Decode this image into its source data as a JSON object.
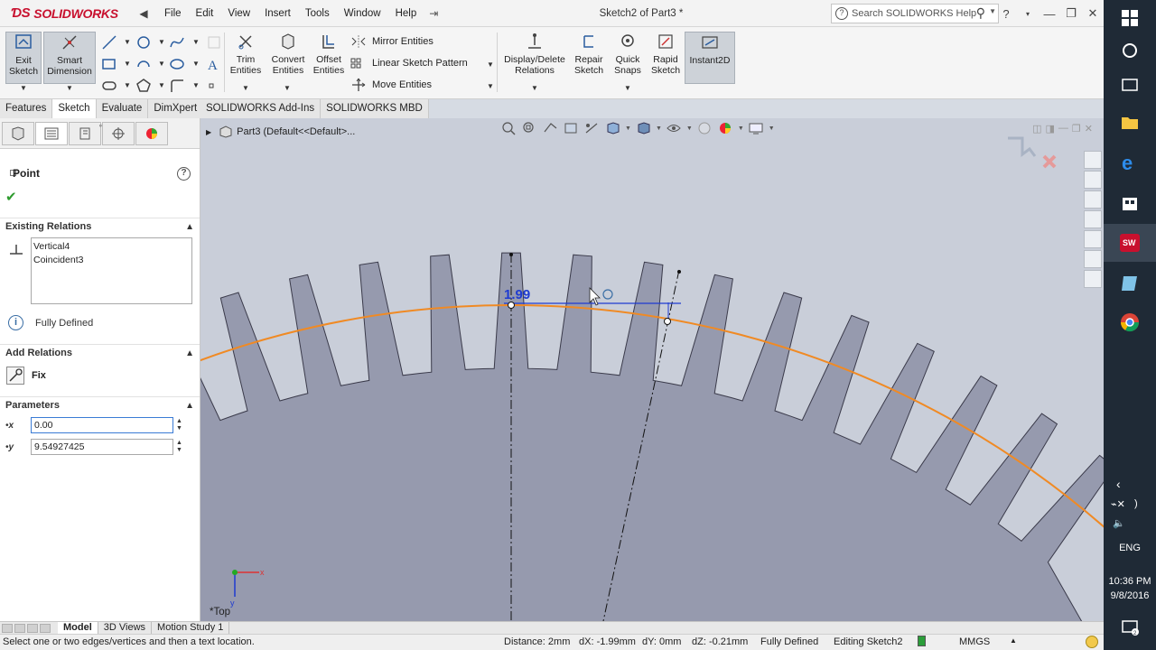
{
  "app": {
    "brand": "SOLIDWORKS",
    "document_title": "Sketch2 of Part3 *",
    "menu": [
      "File",
      "Edit",
      "View",
      "Insert",
      "Tools",
      "Window",
      "Help"
    ],
    "help_search_placeholder": "Search SOLIDWORKS Help"
  },
  "toolbar": {
    "exit_sketch": "Exit Sketch",
    "smart_dimension": "Smart Dimension",
    "trim_entities": "Trim Entities",
    "convert_entities": "Convert Entities",
    "offset_entities": "Offset Entities",
    "mirror_entities": "Mirror Entities",
    "linear_sketch_pattern": "Linear Sketch Pattern",
    "move_entities": "Move Entities",
    "display_delete_relations": "Display/Delete Relations",
    "repair_sketch": "Repair Sketch",
    "quick_snaps": "Quick Snaps",
    "rapid_sketch": "Rapid Sketch",
    "instant2d": "Instant2D"
  },
  "tabs": [
    "Features",
    "Sketch",
    "Evaluate",
    "DimXpert",
    "SOLIDWORKS Add-Ins",
    "SOLIDWORKS MBD"
  ],
  "tabs_active": "Sketch",
  "property_manager": {
    "title": "Point",
    "existing_relations_header": "Existing Relations",
    "existing_relations": [
      "Vertical4",
      "Coincident3"
    ],
    "status": "Fully Defined",
    "add_relations_header": "Add Relations",
    "add_relation_fix": "Fix",
    "parameters_header": "Parameters",
    "param_x_label": "x",
    "param_y_label": "y",
    "param_x_value": "0.00",
    "param_y_value": "9.54927425"
  },
  "viewport": {
    "tree_path": "Part3  (Default<<Default>...",
    "dimension_text": "1.99",
    "view_label": "*Top"
  },
  "bottom_tabs": [
    "Model",
    "3D Views",
    "Motion Study 1"
  ],
  "bottom_tabs_active": "Model",
  "statusbar": {
    "message": "Select one or two edges/vertices and then a text location.",
    "distance": "Distance: 2mm",
    "dx": "dX: -1.99mm",
    "dy": "dY: 0mm",
    "dz": "dZ: -0.21mm",
    "defined": "Fully Defined",
    "editing": "Editing Sketch2",
    "units": "MMGS"
  },
  "taskbar": {
    "language": "ENG",
    "time": "10:36 PM",
    "date": "9/8/2016"
  },
  "colors": {
    "gear_fill": "#969aae",
    "pitch_circle": "#f08a24",
    "dimension_blue": "#1f3bd1",
    "viewport_bg": "#c9ced9",
    "taskbar_bg": "#1f2a36"
  }
}
